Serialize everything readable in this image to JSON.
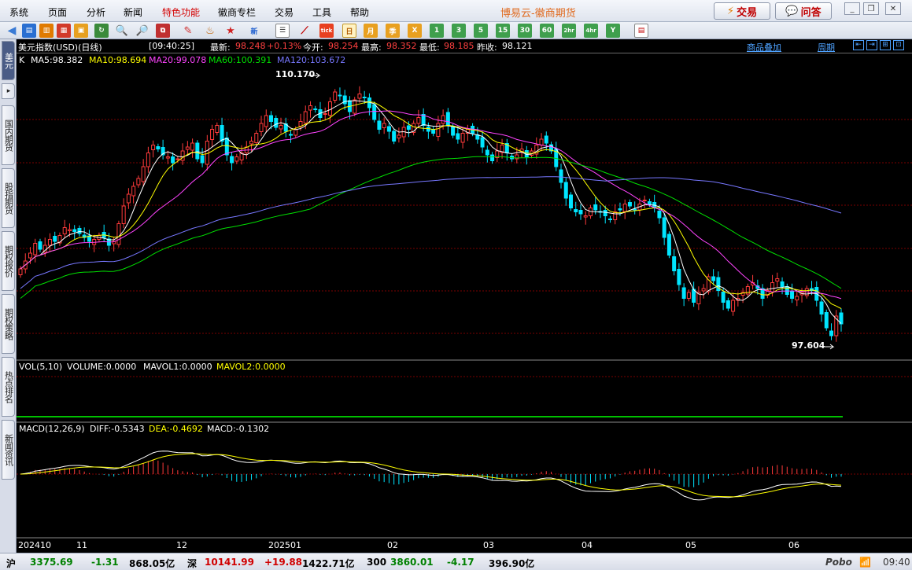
{
  "menu": [
    "系统",
    "页面",
    "分析",
    "新闻",
    "特色功能",
    "徽商专栏",
    "交易",
    "工具",
    "帮助"
  ],
  "menu_highlight": "特色功能",
  "app_title": "博易云-徽商期货",
  "buttons": {
    "trade": "交易",
    "ask": "问答"
  },
  "toolbar_periods": [
    "日",
    "月",
    "季",
    "X",
    "1",
    "3",
    "5",
    "15",
    "30",
    "60",
    "2hr",
    "4hr",
    "Y"
  ],
  "toolbar_selected": "日",
  "left_tabs": [
    {
      "label": "美元",
      "active": true
    },
    {
      "label": "国内期货",
      "active": false
    },
    {
      "label": "股指期货",
      "active": false
    },
    {
      "label": "期权报价",
      "active": false
    },
    {
      "label": "期权策略",
      "active": false
    },
    {
      "label": "热点排名",
      "active": false
    },
    {
      "label": "新闻资讯",
      "active": false
    }
  ],
  "header": {
    "instrument": "美元指数(USD)(日线)",
    "time": "[09:40:25]",
    "latest_label": "最新:",
    "latest": "98.248",
    "change": "+0.13%",
    "open_label": "今开:",
    "open": "98.254",
    "high_label": "最高:",
    "high": "98.352",
    "low_label": "最低:",
    "low": "98.185",
    "prev_label": "昨收:",
    "prev": "98.121",
    "overlay_link": "商品叠加",
    "period_link": "周期"
  },
  "indicators": {
    "k": "K",
    "ma5": "MA5:98.382",
    "ma10": "MA10:98.694",
    "ma20": "MA20:99.078",
    "ma60": "MA60:100.391",
    "ma120": "MA120:103.672",
    "vol": "VOL(5,10)",
    "volume": "VOLUME:0.0000",
    "mavol1": "MAVOL1:0.0000",
    "mavol2": "MAVOL2:0.0000",
    "macd": "MACD(12,26,9)",
    "diff": "DIFF:-0.5343",
    "dea": "DEA:-0.4692",
    "macdv": "MACD:-0.1302"
  },
  "markers": {
    "high": "110.170",
    "low": "97.604"
  },
  "xaxis": [
    "202410",
    "11",
    "12",
    "202501",
    "02",
    "03",
    "04",
    "05",
    "06"
  ],
  "colors": {
    "up": "#ff3b3b",
    "down": "#00e5ff",
    "ma5": "#ffffff",
    "ma10": "#ffff00",
    "ma20": "#ff44ff",
    "ma60": "#00e000",
    "ma120": "#7777ff",
    "grid": "#7a0000"
  },
  "status": {
    "sh_label": "沪",
    "sh_value": "3375.69",
    "sh_change": "-1.31",
    "sh_amount": "868.05亿",
    "sz_label": "深",
    "sz_value": "10141.99",
    "sz_change": "+19.88",
    "sz_amount": "1422.71亿",
    "i300_label": "300",
    "i300_value": "3860.01",
    "i300_change": "-4.17",
    "i300_amount": "396.90亿",
    "brand": "Pobo",
    "clock": "09:40"
  },
  "chart_data": {
    "type": "candlestick",
    "instrument": "美元指数(USD)",
    "period": "日线",
    "x": [
      "2024-10",
      "2024-11",
      "2024-12",
      "2025-01",
      "2025-02",
      "2025-03",
      "2025-04",
      "2025-05",
      "2025-06"
    ],
    "closes": [
      101.0,
      101.4,
      101.8,
      102.3,
      102.0,
      102.2,
      102.5,
      102.4,
      102.7,
      103.1,
      103.0,
      102.9,
      102.8,
      102.6,
      102.4,
      102.5,
      102.7,
      102.6,
      102.2,
      102.4,
      103.3,
      104.2,
      104.8,
      105.2,
      105.6,
      106.2,
      106.9,
      107.3,
      107.1,
      106.8,
      106.7,
      106.4,
      106.6,
      107.0,
      107.2,
      107.4,
      106.6,
      106.4,
      107.5,
      108.1,
      108.3,
      107.5,
      106.8,
      106.4,
      106.7,
      106.9,
      107.2,
      107.5,
      107.9,
      108.4,
      108.8,
      108.5,
      108.2,
      108.3,
      108.0,
      107.8,
      108.1,
      108.5,
      109.0,
      109.3,
      109.1,
      108.7,
      108.9,
      109.5,
      110.0,
      109.8,
      109.4,
      109.0,
      109.6,
      109.9,
      109.7,
      109.2,
      108.6,
      108.1,
      108.4,
      108.0,
      107.5,
      107.8,
      108.2,
      108.1,
      108.4,
      108.7,
      108.3,
      108.0,
      107.9,
      108.4,
      108.8,
      108.3,
      107.8,
      107.6,
      107.9,
      108.1,
      107.9,
      107.6,
      107.2,
      106.8,
      106.5,
      107.0,
      107.3,
      106.9,
      106.6,
      106.8,
      107.1,
      106.7,
      107.0,
      107.3,
      107.6,
      107.4,
      107.0,
      106.2,
      105.4,
      104.6,
      104.1,
      103.9,
      103.8,
      103.7,
      104.1,
      104.0,
      103.9,
      103.7,
      103.5,
      103.9,
      104.0,
      104.3,
      104.2,
      104.0,
      104.3,
      104.5,
      104.3,
      104.1,
      103.6,
      102.6,
      101.7,
      100.9,
      100.2,
      99.5,
      99.8,
      99.3,
      99.8,
      100.0,
      100.6,
      100.4,
      99.9,
      99.3,
      99.0,
      99.4,
      99.5,
      99.8,
      100.1,
      100.3,
      100.0,
      99.5,
      99.9,
      100.3,
      100.5,
      100.1,
      99.7,
      99.5,
      99.6,
      99.8,
      100.0,
      99.9,
      99.4,
      98.7,
      98.0,
      97.6,
      98.6,
      98.2
    ]
  }
}
